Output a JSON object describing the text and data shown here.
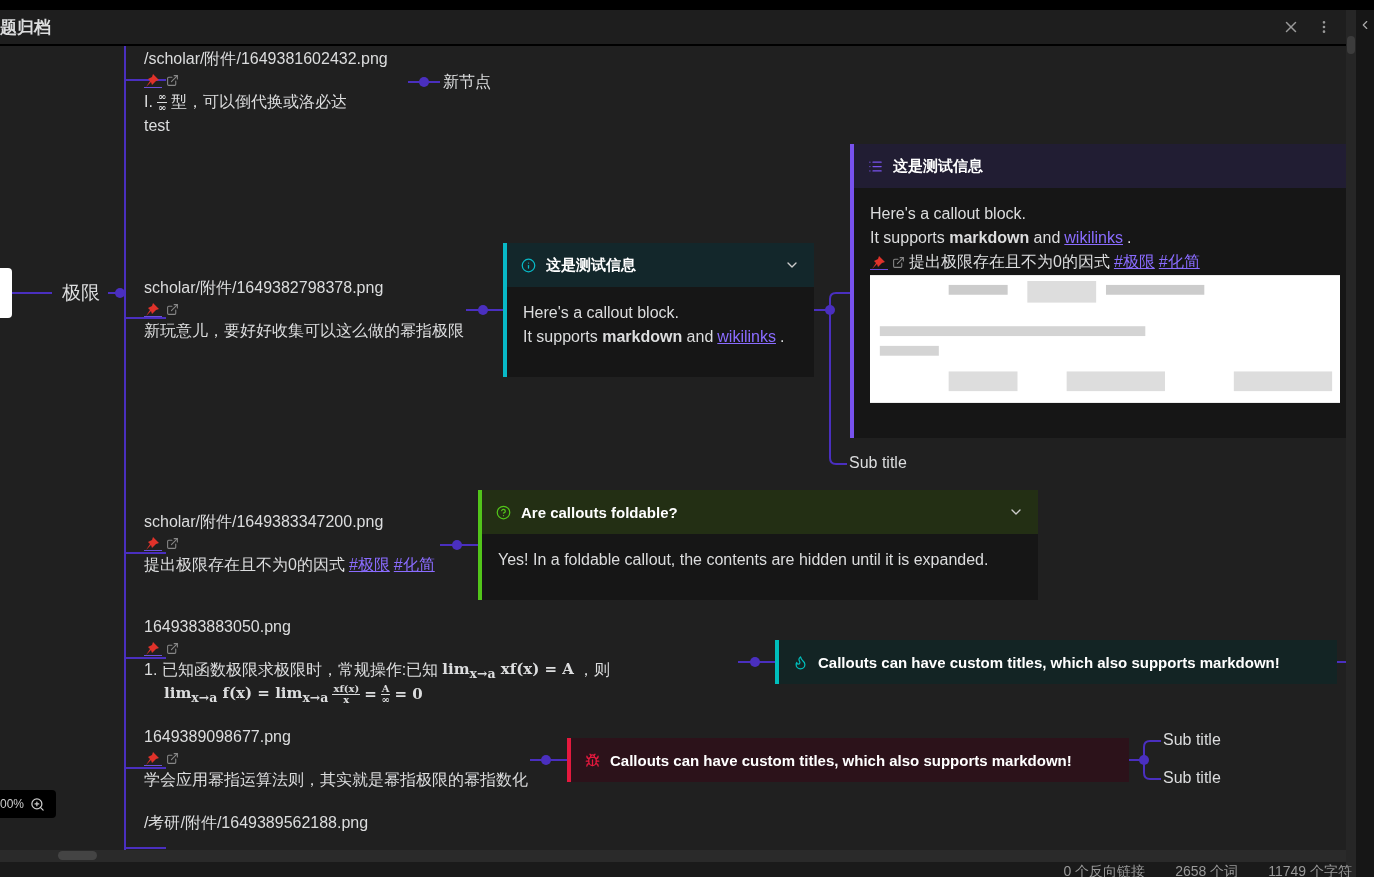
{
  "header": {
    "title": "题归档"
  },
  "root": {
    "label": "极限"
  },
  "nodes": [
    {
      "file": "/scholar/附件/1649381602432.png",
      "pin_row": true,
      "lines": [
        [
          {
            "kind": "text",
            "t": "I. "
          },
          {
            "kind": "frac",
            "num": "∞",
            "den": "∞"
          },
          {
            "kind": "text",
            "t": "型，可以倒代换或洛必达"
          }
        ],
        [
          {
            "kind": "text",
            "t": "test"
          }
        ]
      ]
    },
    {
      "file": "scholar/附件/1649382798378.png",
      "pin_row": true,
      "lines": [
        [
          {
            "kind": "text",
            "t": "新玩意儿，要好好收集可以这么做的幂指极限"
          }
        ]
      ]
    },
    {
      "file": "scholar/附件/1649383347200.png",
      "pin_row": true,
      "lines": [
        [
          {
            "kind": "text",
            "t": "提出极限存在且不为0的因式"
          },
          {
            "kind": "tag",
            "t": "#极限"
          },
          {
            "kind": "tag",
            "t": "#化简"
          }
        ]
      ]
    },
    {
      "file": "1649383883050.png",
      "pin_row": true,
      "lines": [
        [
          {
            "kind": "text",
            "t": "1. 已知函数极限求极限时，常规操作:已知"
          },
          {
            "kind": "math",
            "t": "lim$_{x→a}$ xf(x) = A"
          },
          {
            "kind": "text",
            "t": "，则"
          }
        ],
        [
          {
            "kind": "math",
            "t": "lim$_{x→a}$ f(x) = lim$_{x→a}$"
          },
          {
            "kind": "frac",
            "num": "xf(x)",
            "den": "x"
          },
          {
            "kind": "math",
            "t": "="
          },
          {
            "kind": "frac",
            "num": "A",
            "den": "∞"
          },
          {
            "kind": "math",
            "t": "= 0"
          }
        ]
      ]
    },
    {
      "file": "1649389098677.png",
      "pin_row": true,
      "lines": [
        [
          {
            "kind": "text",
            "t": "学会应用幂指运算法则，其实就是幂指极限的幂指数化"
          }
        ]
      ]
    },
    {
      "file": "/考研/附件/1649389562188.png",
      "pin_row": false
    }
  ],
  "callouts": [
    {
      "kind": "info",
      "title": "这是测试信息",
      "foldable": true,
      "body": [
        [
          {
            "kind": "text",
            "t": "Here's a callout block."
          }
        ],
        [
          {
            "kind": "text",
            "t": "It supports **markdown** and"
          },
          {
            "kind": "link",
            "t": "wikilinks"
          },
          {
            "kind": "text",
            "t": "."
          }
        ]
      ]
    },
    {
      "kind": "list",
      "title": "这是测试信息",
      "foldable": false,
      "body": [
        [
          {
            "kind": "text",
            "t": "Here's a callout block."
          }
        ],
        [
          {
            "kind": "text",
            "t": "It supports **markdown** and"
          },
          {
            "kind": "link",
            "t": "wikilinks"
          },
          {
            "kind": "text",
            "t": "."
          }
        ],
        [
          {
            "kind": "pins"
          },
          {
            "kind": "text",
            "t": "提出极限存在且不为0的因式"
          },
          {
            "kind": "tag",
            "t": "#极限"
          },
          {
            "kind": "tag",
            "t": "#化简"
          }
        ],
        [
          {
            "kind": "picture"
          }
        ]
      ]
    },
    {
      "kind": "question",
      "title": "Are callouts foldable?",
      "foldable": true,
      "body": [
        [
          {
            "kind": "text",
            "t": "Yes! In a foldable callout, the contents are hidden until it is expanded."
          }
        ]
      ]
    },
    {
      "kind": "tip",
      "title": "Callouts can have custom titles, which also supports markdown!",
      "foldable": false
    },
    {
      "kind": "bug",
      "title": "Callouts can have custom titles, which also supports markdown!",
      "foldable": false
    }
  ],
  "labels": [
    "新节点",
    "Sub title",
    "Sub title",
    "Sub title"
  ],
  "zoom": {
    "label": "00%"
  },
  "status_bar": [
    "0 个反向链接",
    "2658 个词",
    "11749 个字符"
  ]
}
